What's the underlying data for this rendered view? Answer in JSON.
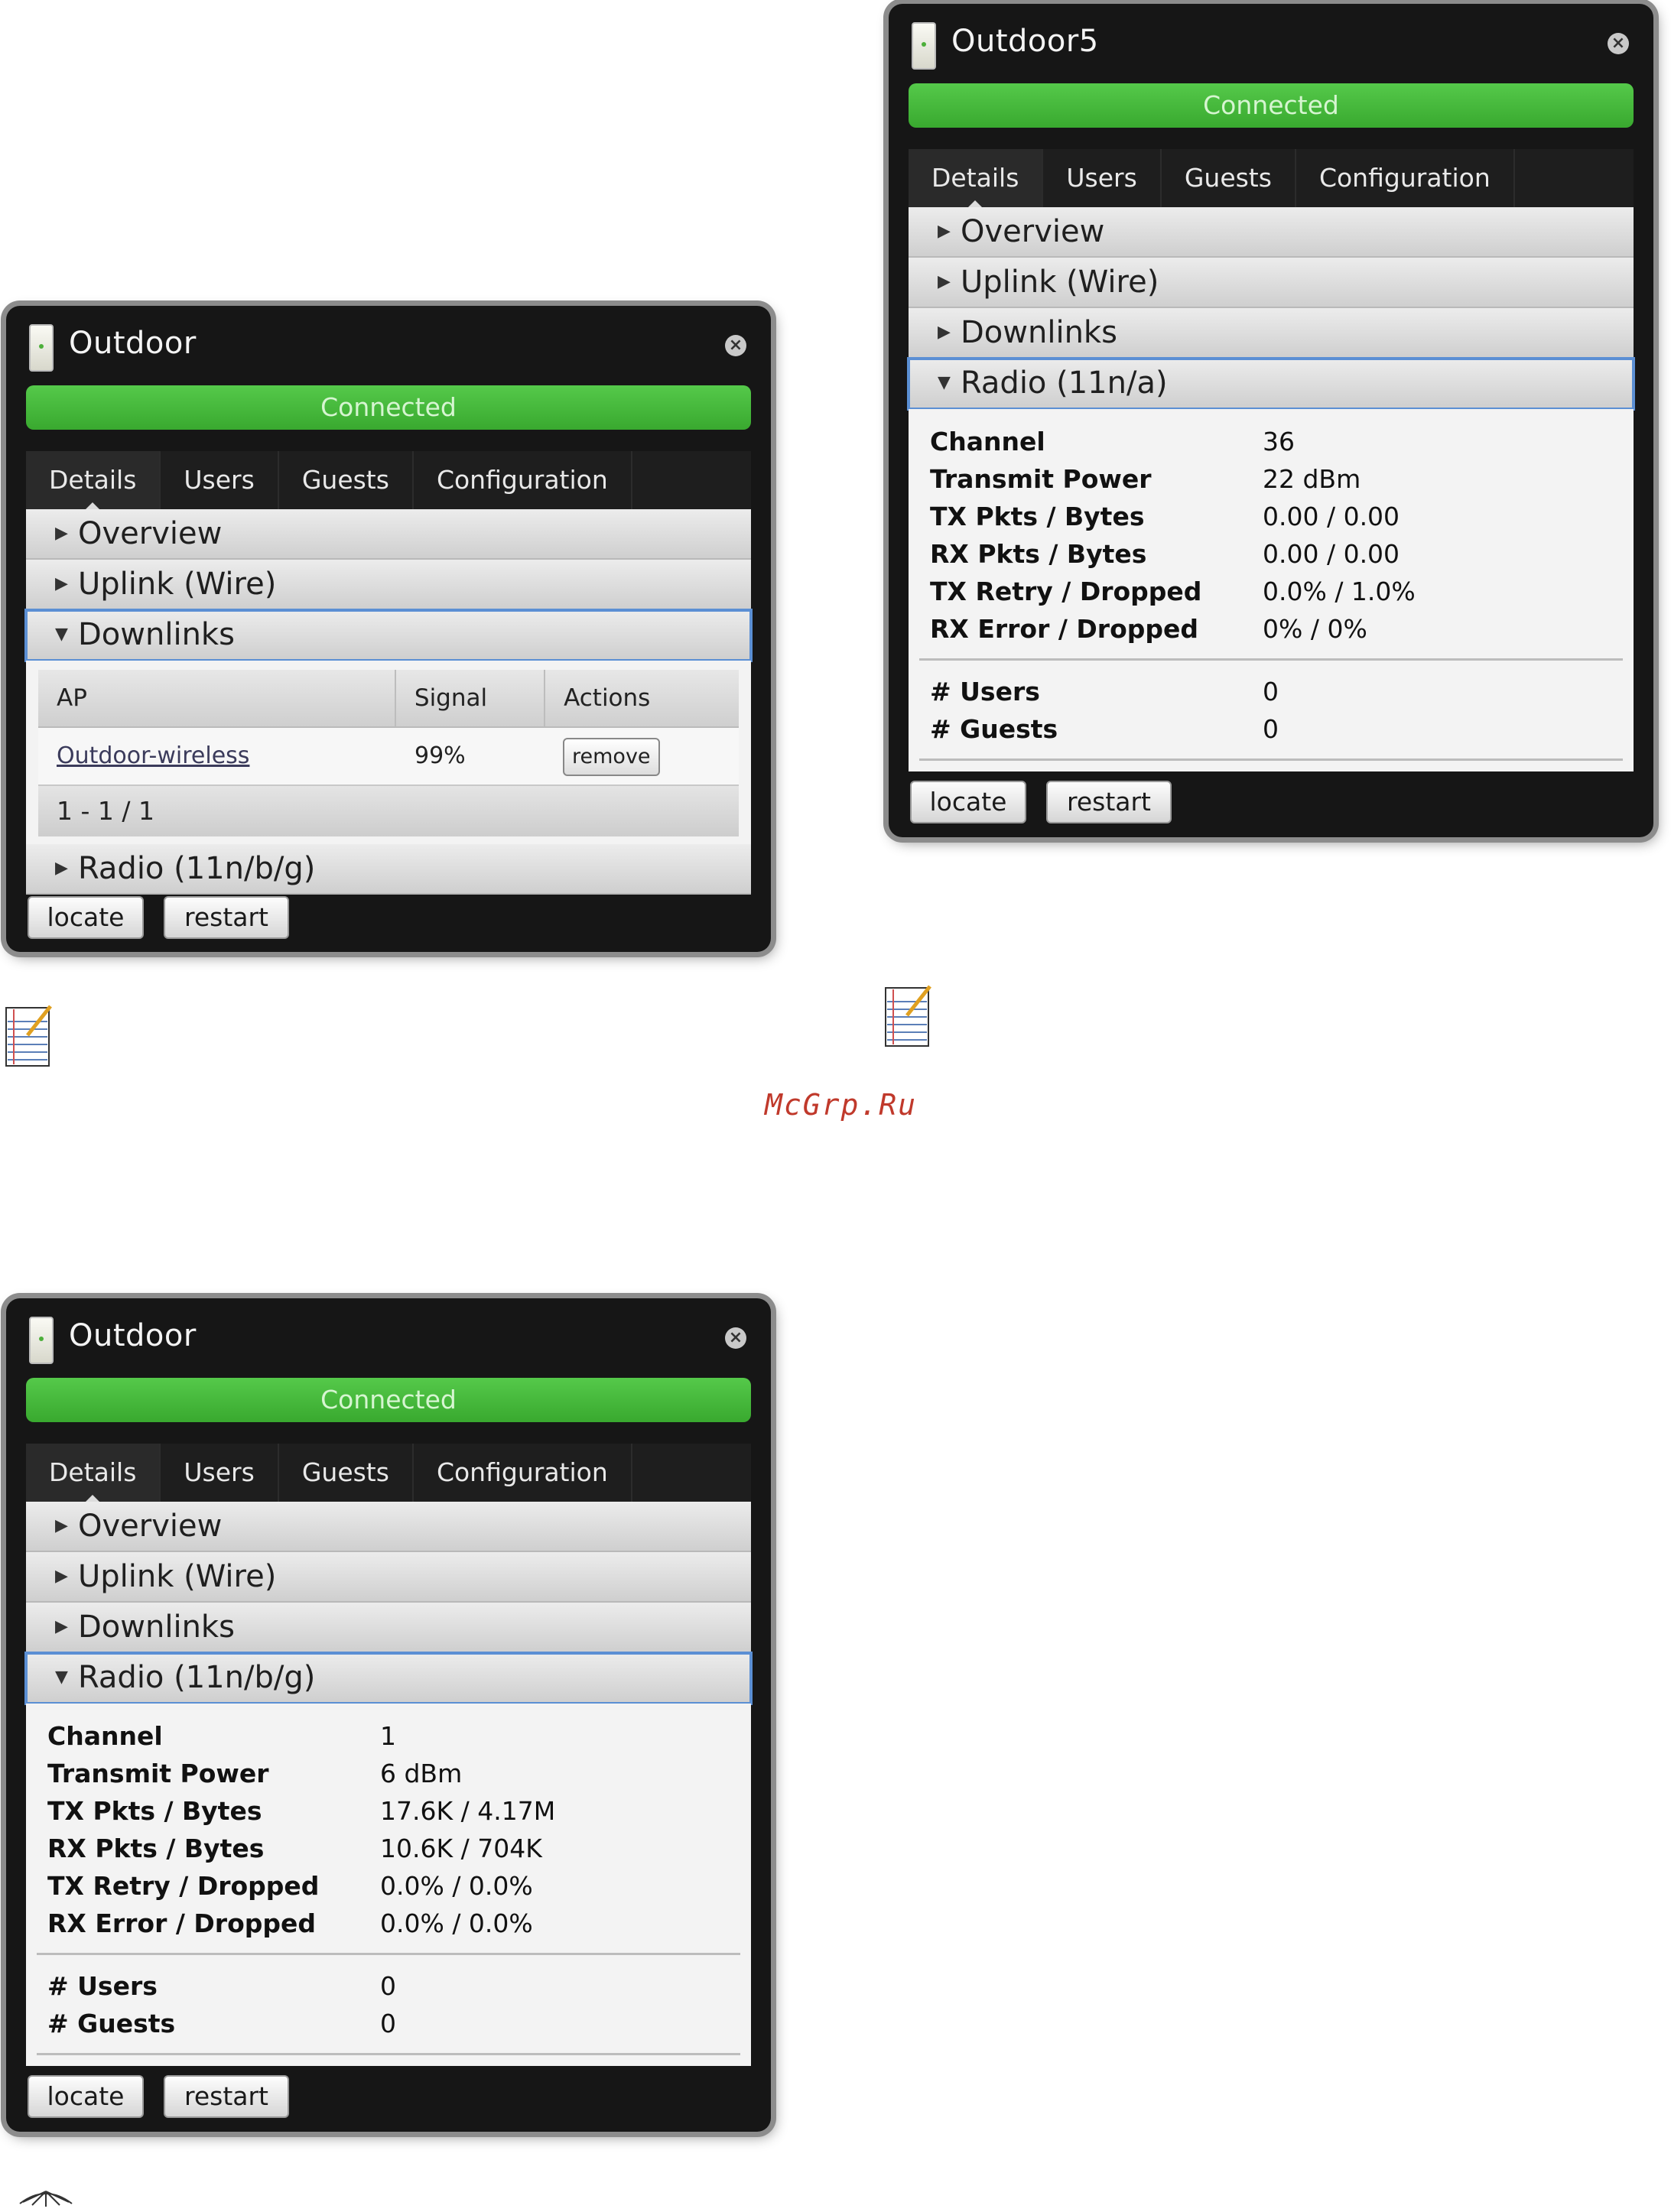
{
  "panel_a": {
    "name": "Outdoor",
    "status": "Connected",
    "tabs": [
      "Details",
      "Users",
      "Guests",
      "Configuration"
    ],
    "sections": {
      "overview": "Overview",
      "uplink": "Uplink (Wire)",
      "downlinks": "Downlinks",
      "radio": "Radio (11n/b/g)"
    },
    "table": {
      "headers": [
        "AP",
        "Signal",
        "Actions"
      ],
      "row": {
        "ap": "Outdoor-wireless",
        "signal": "99%",
        "action": "remove"
      },
      "pager": "1 - 1 / 1"
    },
    "buttons": {
      "locate": "locate",
      "restart": "restart"
    }
  },
  "panel_b": {
    "name": "Outdoor5",
    "status": "Connected",
    "tabs": [
      "Details",
      "Users",
      "Guests",
      "Configuration"
    ],
    "sections": {
      "overview": "Overview",
      "uplink": "Uplink (Wire)",
      "downlinks": "Downlinks",
      "radio": "Radio (11n/a)"
    },
    "stats": [
      {
        "label": "Channel",
        "value": "36"
      },
      {
        "label": "Transmit Power",
        "value": "22 dBm"
      },
      {
        "label": "TX Pkts / Bytes",
        "value": "0.00 / 0.00"
      },
      {
        "label": "RX Pkts / Bytes",
        "value": "0.00 / 0.00"
      },
      {
        "label": "TX Retry / Dropped",
        "value": "0.0% / 1.0%"
      },
      {
        "label": "RX Error / Dropped",
        "value": "0% / 0%"
      }
    ],
    "counts": [
      {
        "label": "# Users",
        "value": "0"
      },
      {
        "label": "# Guests",
        "value": "0"
      }
    ],
    "buttons": {
      "locate": "locate",
      "restart": "restart"
    }
  },
  "panel_c": {
    "name": "Outdoor",
    "status": "Connected",
    "tabs": [
      "Details",
      "Users",
      "Guests",
      "Configuration"
    ],
    "sections": {
      "overview": "Overview",
      "uplink": "Uplink (Wire)",
      "downlinks": "Downlinks",
      "radio": "Radio (11n/b/g)"
    },
    "stats": [
      {
        "label": "Channel",
        "value": "1"
      },
      {
        "label": "Transmit Power",
        "value": "6 dBm"
      },
      {
        "label": "TX Pkts / Bytes",
        "value": "17.6K / 4.17M"
      },
      {
        "label": "RX Pkts / Bytes",
        "value": "10.6K / 704K"
      },
      {
        "label": "TX Retry / Dropped",
        "value": "0.0% / 0.0%"
      },
      {
        "label": "RX Error / Dropped",
        "value": "0.0% / 0.0%"
      }
    ],
    "counts": [
      {
        "label": "# Users",
        "value": "0"
      },
      {
        "label": "# Guests",
        "value": "0"
      }
    ],
    "buttons": {
      "locate": "locate",
      "restart": "restart"
    }
  },
  "watermark": "McGrp.Ru",
  "icons": [
    "device-icon",
    "close-icon",
    "caret-right-icon",
    "caret-down-icon",
    "notepad-icon"
  ]
}
